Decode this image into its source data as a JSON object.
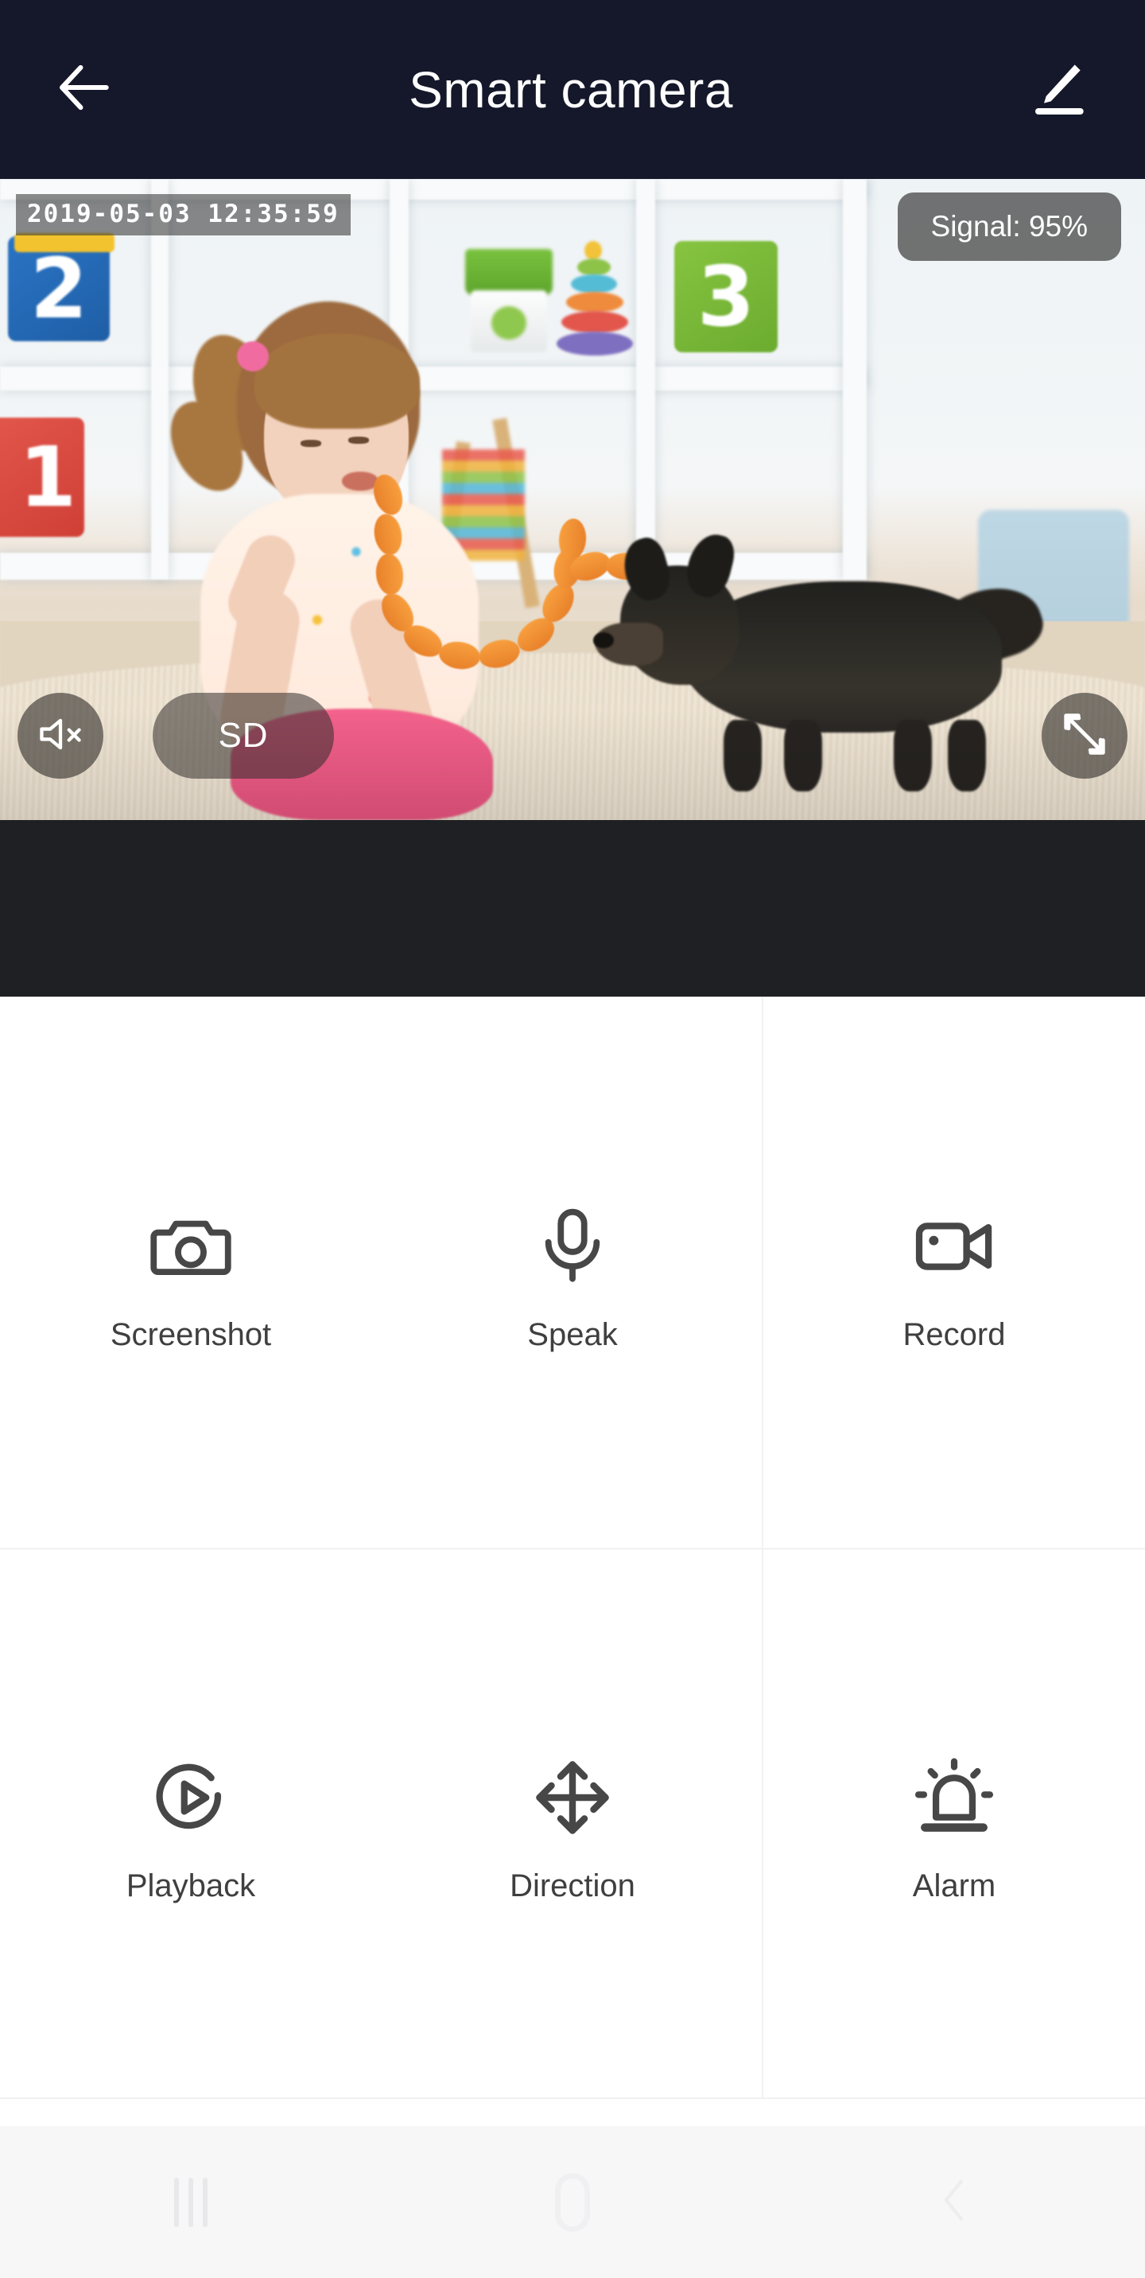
{
  "header": {
    "title": "Smart camera",
    "back_icon": "arrow-left-icon",
    "edit_icon": "pencil-icon"
  },
  "video": {
    "timestamp": "2019-05-03 12:35:59",
    "signal_label": "Signal: 95%",
    "quality_label": "SD",
    "mute_icon": "speaker-mute-icon",
    "fullscreen_icon": "fullscreen-expand-icon",
    "scene_description": "Young girl in floral dress sitting on cream rug feeding a chain of sausages to a black long-haired chihuahua in a bright nursery room with white shelving"
  },
  "functions": [
    {
      "label": "Screenshot",
      "icon": "camera-icon",
      "name": "screenshot"
    },
    {
      "label": "Speak",
      "icon": "microphone-icon",
      "name": "speak"
    },
    {
      "label": "Record",
      "icon": "video-camera-icon",
      "name": "record"
    },
    {
      "label": "Playback",
      "icon": "play-circle-icon",
      "name": "playback"
    },
    {
      "label": "Direction",
      "icon": "move-arrows-icon",
      "name": "direction"
    },
    {
      "label": "Alarm",
      "icon": "siren-icon",
      "name": "alarm"
    }
  ],
  "navbar": {
    "recents_icon": "recents-icon",
    "home_icon": "home-icon",
    "back_icon": "back-chevron-icon"
  },
  "colors": {
    "header_bg": "#14182a",
    "dark_band": "#1f2024",
    "icon_stroke": "#474747",
    "label_text": "#3f3f3f",
    "divider": "#f1f1f1",
    "navbar_bg": "#f7f7f8"
  }
}
